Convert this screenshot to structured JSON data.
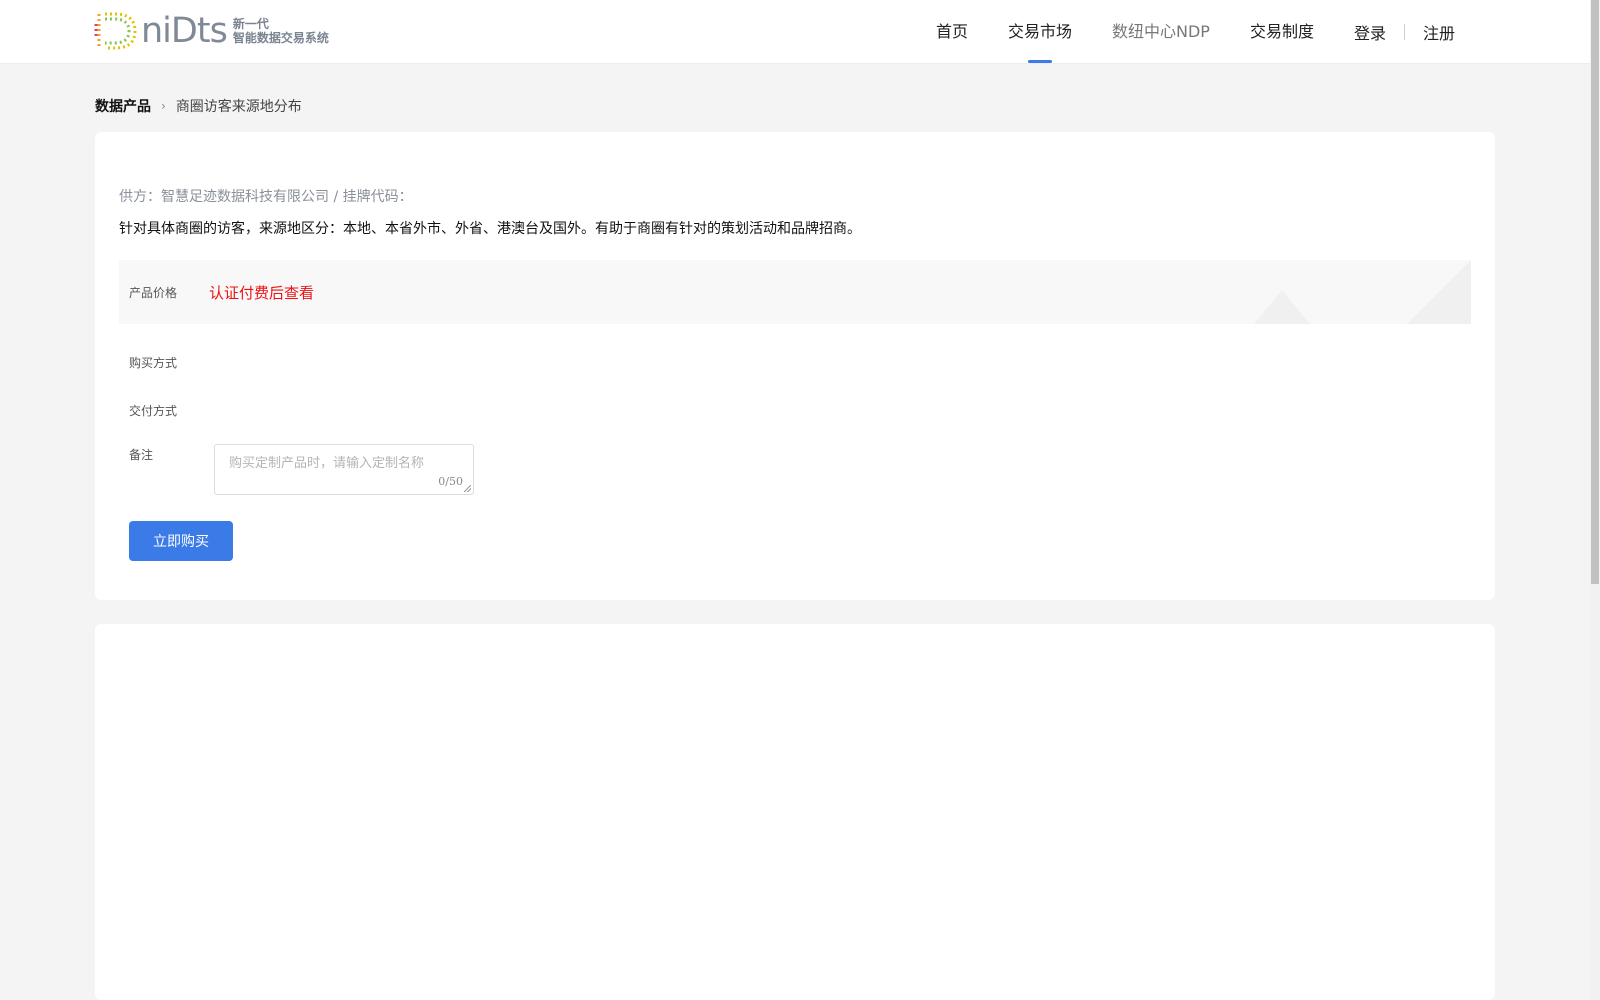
{
  "brand": {
    "name": "niDts",
    "tagline_line1": "新一代",
    "tagline_line2": "智能数据交易系统"
  },
  "nav": {
    "items": [
      {
        "label": "首页",
        "active": false
      },
      {
        "label": "交易市场",
        "active": true
      },
      {
        "label": "数纽中心NDP",
        "active": false
      },
      {
        "label": "交易制度",
        "active": false
      }
    ],
    "login": "登录",
    "register": "注册"
  },
  "breadcrumb": {
    "root": "数据产品",
    "current": "商圈访客来源地分布"
  },
  "product": {
    "supplier": "供方：智慧足迹数据科技有限公司 / 挂牌代码：",
    "description": "针对具体商圈的访客，来源地区分：本地、本省外市、外省、港澳台及国外。有助于商圈有针对的策划活动和品牌招商。",
    "price_label": "产品价格",
    "price_value": "认证付费后查看",
    "purchase_method_label": "购买方式",
    "delivery_method_label": "交付方式",
    "remark_label": "备注",
    "remark_placeholder": "购买定制产品时，请输入定制名称",
    "remark_count": "0/50",
    "buy_button": "立即购买"
  },
  "colors": {
    "accent": "#3a7be8",
    "price": "#ee1111",
    "background": "#f4f4f4"
  }
}
